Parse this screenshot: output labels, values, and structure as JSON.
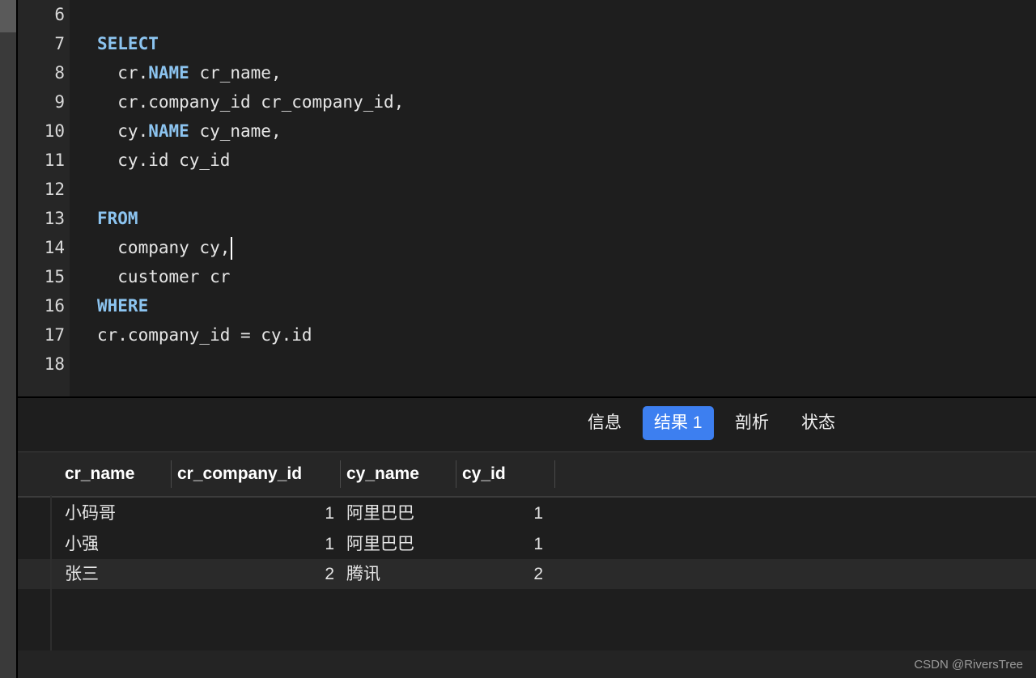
{
  "editor": {
    "lines": [
      {
        "num": "6",
        "parts": []
      },
      {
        "num": "7",
        "parts": [
          {
            "t": "SELECT",
            "kw": true
          }
        ]
      },
      {
        "num": "8",
        "parts": [
          {
            "t": "  cr."
          },
          {
            "t": "NAME",
            "kw": true
          },
          {
            "t": " cr_name,"
          }
        ]
      },
      {
        "num": "9",
        "parts": [
          {
            "t": "  cr.company_id cr_company_id,"
          }
        ]
      },
      {
        "num": "10",
        "parts": [
          {
            "t": "  cy."
          },
          {
            "t": "NAME",
            "kw": true
          },
          {
            "t": " cy_name,"
          }
        ]
      },
      {
        "num": "11",
        "parts": [
          {
            "t": "  cy.id cy_id"
          }
        ]
      },
      {
        "num": "12",
        "parts": []
      },
      {
        "num": "13",
        "parts": [
          {
            "t": "FROM",
            "kw": true
          }
        ]
      },
      {
        "num": "14",
        "parts": [
          {
            "t": "  company cy,"
          }
        ],
        "caret": true
      },
      {
        "num": "15",
        "parts": [
          {
            "t": "  customer cr"
          }
        ]
      },
      {
        "num": "16",
        "parts": [
          {
            "t": "WHERE",
            "kw": true
          }
        ]
      },
      {
        "num": "17",
        "parts": [
          {
            "t": "cr.company_id = cy.id"
          }
        ]
      },
      {
        "num": "18",
        "parts": []
      }
    ]
  },
  "tabs": {
    "info": "信息",
    "result": "结果 1",
    "profile": "剖析",
    "status": "状态",
    "active": "result"
  },
  "grid": {
    "columns": [
      "cr_name",
      "cr_company_id",
      "cy_name",
      "cy_id"
    ],
    "rows": [
      [
        "小码哥",
        "1",
        "阿里巴巴",
        "1"
      ],
      [
        "小强",
        "1",
        "阿里巴巴",
        "1"
      ],
      [
        "张三",
        "2",
        "腾讯",
        "2"
      ]
    ]
  },
  "watermark": "CSDN @RiversTree",
  "colors": {
    "keyword": "#8cc4f0",
    "active_tab": "#3d7ff0",
    "background": "#1e1e1e"
  }
}
